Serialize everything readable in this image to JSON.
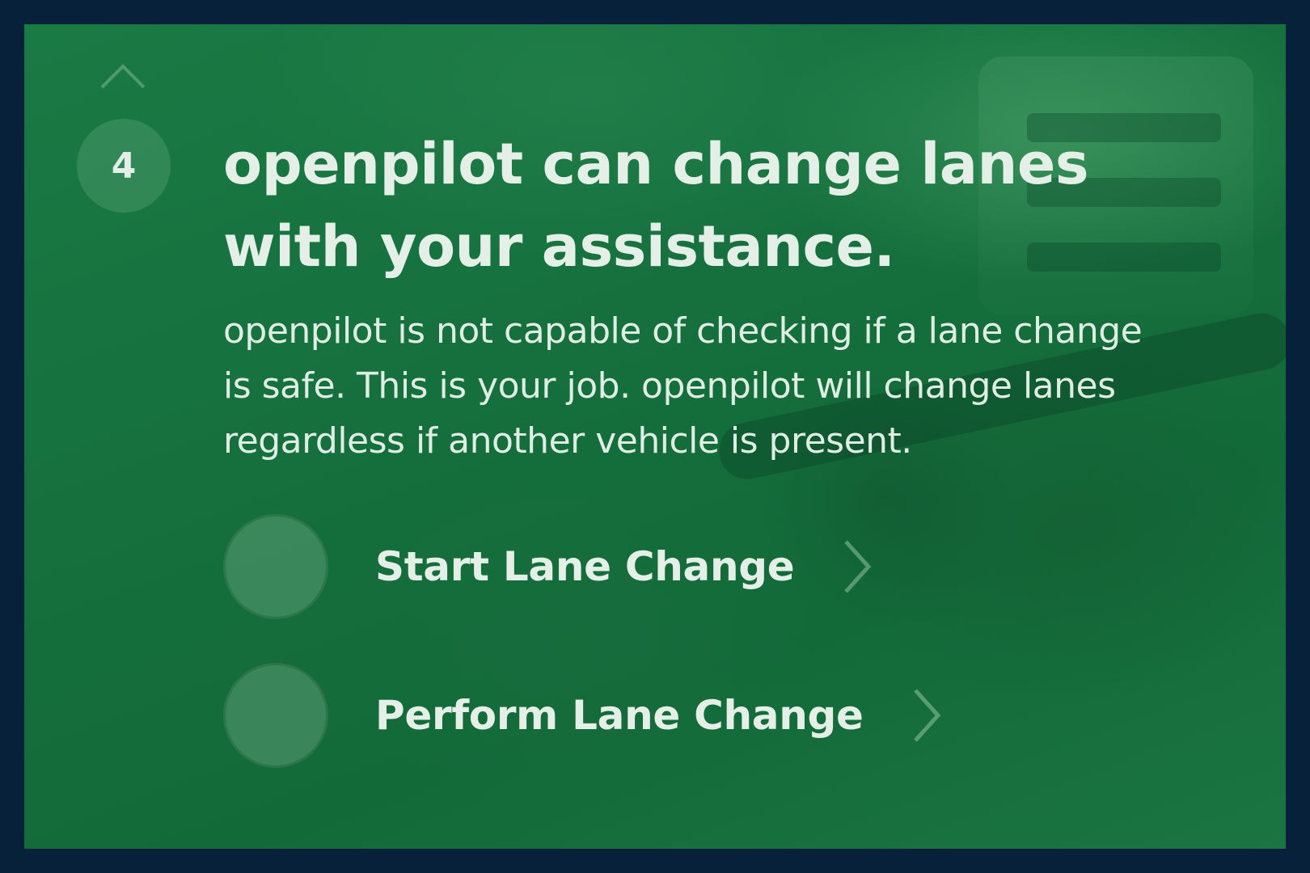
{
  "step": {
    "number": "4"
  },
  "title": {
    "line1": "openpilot can change lanes",
    "line2": "with your assistance."
  },
  "description": {
    "line1": "openpilot is not capable of checking if a lane change",
    "line2": "is safe. This is your job. openpilot will change lanes",
    "line3": "regardless if another vehicle is present."
  },
  "options": [
    {
      "label": "Start Lane Change",
      "icon": "chevron-right-icon"
    },
    {
      "label": "Perform Lane Change",
      "icon": "chevron-right-icon"
    }
  ],
  "navigation": {
    "up_icon": "chevron-up-icon"
  },
  "colors": {
    "outer_border": "#07213a",
    "background": "#15703d",
    "text": "#e4efe7"
  }
}
